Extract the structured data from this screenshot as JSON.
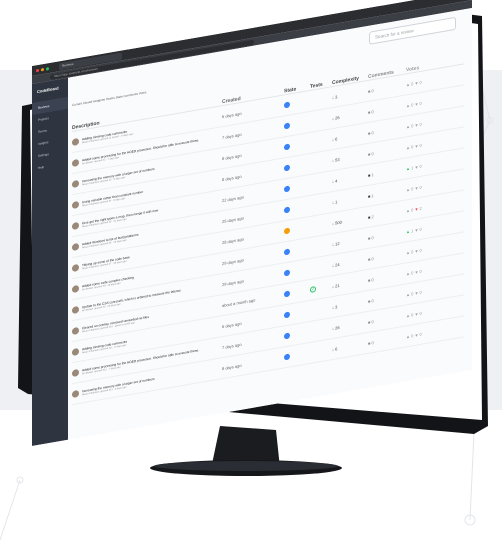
{
  "browser": {
    "tab_label": "Reviews",
    "url": "https://app.example.com/reviews"
  },
  "sidebar": {
    "logo": "CodeBoard",
    "items": [
      {
        "label": "Reviews",
        "active": true
      },
      {
        "label": "Projects",
        "active": false
      },
      {
        "label": "Teams",
        "active": false
      },
      {
        "label": "Insights",
        "active": false
      },
      {
        "label": "Settings",
        "active": false
      },
      {
        "label": "Help",
        "active": false
      }
    ]
  },
  "header": {
    "search_placeholder": "Search for a review",
    "filters_text": "Current  Closed  Assignee  Teams  State  Comments  Votes"
  },
  "table": {
    "columns": {
      "description": "Description",
      "created": "Created",
      "state": "State",
      "tests": "Tests",
      "complexity": "Complexity",
      "comments": "Comments",
      "votes": "Votes"
    },
    "rows": [
      {
        "title": "Adding missing code comments",
        "sub": "Alison Chalmers opened #1 project · 6 days ago",
        "created": "6 days ago",
        "state": "blue",
        "tests": "",
        "complexity": "3",
        "comments": "0",
        "up": "0",
        "down": "0"
      },
      {
        "title": "Added some processing for the HOED processor. Should be able to execute these.",
        "sub": "Ian Becker opened #2 · 7 days ago",
        "created": "7 days ago",
        "state": "blue",
        "tests": "",
        "complexity": "26",
        "comments": "0",
        "up": "0",
        "down": "0"
      },
      {
        "title": "Increasing the memory with a larger set of numbers",
        "sub": "Alison Chalmers opened #3 · 8 days ago",
        "created": "8 days ago",
        "state": "blue",
        "tests": "",
        "complexity": "6",
        "comments": "0",
        "up": "0",
        "down": "0"
      },
      {
        "title": "Using variable rather than constant number",
        "sub": "Alison Chalmers opened #4 · 8 days ago",
        "created": "8 days ago",
        "state": "blue",
        "tests": "",
        "complexity": "53",
        "comments": "0",
        "up": "0",
        "down": "0"
      },
      {
        "title": "Give get the right types a map, then merge it with now",
        "sub": "Alison Chalmers opened #5 · 22 days ago",
        "created": "22 days ago",
        "state": "blue",
        "tests": "",
        "complexity": "4",
        "comments": "1",
        "up": "1",
        "down": "0"
      },
      {
        "title": "Added Windows to list of build platforms",
        "sub": "Alison Chalmers opened #6 · 25 days ago",
        "created": "25 days ago",
        "state": "blue",
        "tests": "",
        "complexity": "1",
        "comments": "1",
        "up": "0",
        "down": "0"
      },
      {
        "title": "Tidying up some of the code base",
        "sub": "Alison Chalmers opened #7 · 28 days ago",
        "created": "28 days ago",
        "state": "orange",
        "tests": "",
        "complexity": "500",
        "comments": "2",
        "up": "0",
        "down": "2"
      },
      {
        "title": "Added some code complex checking",
        "sub": "Ian Becker opened #8 · 29 days ago",
        "created": "29 days ago",
        "state": "blue",
        "tests": "",
        "complexity": "12",
        "comments": "0",
        "up": "1",
        "down": "0"
      },
      {
        "title": "Update to the CSS core path, which is ordered to measure the latency",
        "sub": "Ian Becker opened #9 · 29 days ago",
        "created": "29 days ago",
        "state": "blue",
        "tests": "",
        "complexity": "24",
        "comments": "0",
        "up": "0",
        "down": "0"
      },
      {
        "title": "Cleared an overlay, removed unneeded no-files",
        "sub": "Alison Chalmers opened #10 · about a month ago",
        "created": "about a month ago",
        "state": "blue",
        "tests": "ok",
        "complexity": "21",
        "comments": "0",
        "up": "0",
        "down": "0"
      },
      {
        "title": "Adding missing code comments",
        "sub": "Alison Chalmers opened #11 · 6 days ago",
        "created": "6 days ago",
        "state": "blue",
        "tests": "",
        "complexity": "3",
        "comments": "0",
        "up": "0",
        "down": "0"
      },
      {
        "title": "Added some processing for the HOED processor. Should be able to execute these.",
        "sub": "Ian Becker opened #12 · 7 days ago",
        "created": "7 days ago",
        "state": "blue",
        "tests": "",
        "complexity": "26",
        "comments": "0",
        "up": "0",
        "down": "0"
      },
      {
        "title": "Increasing the memory with a larger set of numbers",
        "sub": "Alison Chalmers opened #13 · 8 days ago",
        "created": "8 days ago",
        "state": "blue",
        "tests": "",
        "complexity": "6",
        "comments": "0",
        "up": "0",
        "down": "0"
      }
    ]
  }
}
